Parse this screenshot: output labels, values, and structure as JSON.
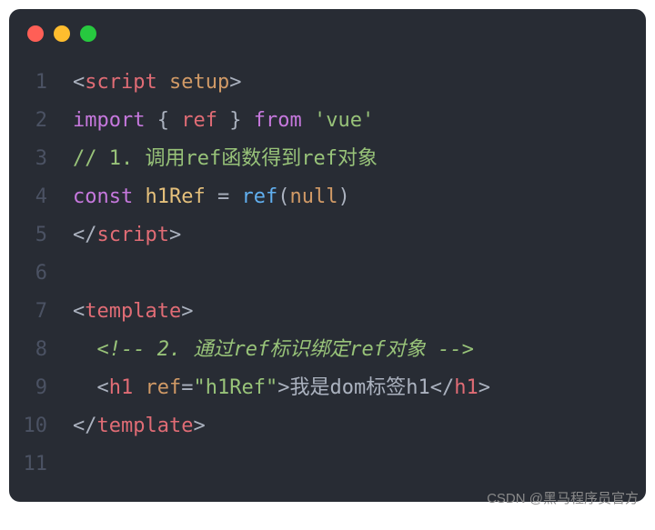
{
  "window": {
    "buttons": [
      "close",
      "minimize",
      "zoom"
    ]
  },
  "code": {
    "lines": [
      "1",
      "2",
      "3",
      "4",
      "5",
      "6",
      "7",
      "8",
      "9",
      "10",
      "11"
    ],
    "line1": {
      "lt": "<",
      "tag": "script",
      "sp": " ",
      "attr": "setup",
      "gt": ">"
    },
    "line2": {
      "kw": "import",
      "s1": " ",
      "lb": "{",
      "s2": " ",
      "id": "ref",
      "s3": " ",
      "rb": "}",
      "s4": " ",
      "from": "from",
      "s5": " ",
      "str": "'vue'"
    },
    "line3": {
      "comment": "// 1. 调用ref函数得到ref对象"
    },
    "line4": {
      "kw": "const",
      "s1": " ",
      "var": "h1Ref",
      "s2": " ",
      "eq": "=",
      "s3": " ",
      "fn": "ref",
      "lp": "(",
      "nil": "null",
      "rp": ")"
    },
    "line5": {
      "lt": "</",
      "tag": "script",
      "gt": ">"
    },
    "line7": {
      "lt": "<",
      "tag": "template",
      "gt": ">"
    },
    "line8": {
      "indent": "  ",
      "comment": "<!-- 2. 通过ref标识绑定ref对象 -->"
    },
    "line9": {
      "indent": "  ",
      "lt": "<",
      "tag": "h1",
      "s1": " ",
      "attr": "ref",
      "eq": "=",
      "val": "\"h1Ref\"",
      "gt": ">",
      "text": "我是dom标签h1",
      "lt2": "</",
      "tag2": "h1",
      "gt2": ">"
    },
    "line10": {
      "lt": "</",
      "tag": "template",
      "gt": ">"
    }
  },
  "watermark": "CSDN @黑马程序员官方"
}
